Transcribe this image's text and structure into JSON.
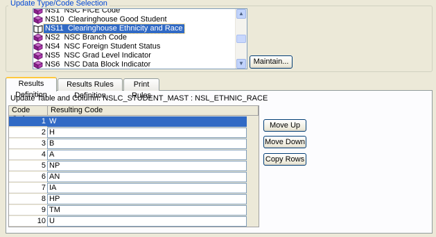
{
  "selection_group": {
    "title": "Update Type/Code Selection",
    "items": [
      {
        "code": "NS1",
        "label": "NSC FICE Code"
      },
      {
        "code": "NS10",
        "label": "Clearinghouse Good Student"
      },
      {
        "code": "NS11",
        "label": "Clearinghouse Ethnicity and Race",
        "selected": true
      },
      {
        "code": "NS2",
        "label": "NSC Branch Code"
      },
      {
        "code": "NS4",
        "label": "NSC Foreign Student Status"
      },
      {
        "code": "NS5",
        "label": "NSC Grad Level Indicator"
      },
      {
        "code": "NS6",
        "label": "NSC Data Block Indicator"
      }
    ],
    "maintain_label": "Maintain..."
  },
  "tabs": [
    {
      "label": "Results Definition",
      "active": true
    },
    {
      "label": "Results Rules Definition"
    },
    {
      "label": "Print Rules"
    }
  ],
  "results": {
    "update_label": "Update Table and Column: NSLC_STUDENT_MAST : NSL_ETHNIC_RACE",
    "columns": [
      "Code Order",
      "Resulting Code"
    ],
    "rows": [
      {
        "order": "1",
        "code": "W"
      },
      {
        "order": "2",
        "code": "H"
      },
      {
        "order": "3",
        "code": "B"
      },
      {
        "order": "4",
        "code": "A"
      },
      {
        "order": "5",
        "code": "NP"
      },
      {
        "order": "6",
        "code": "AN"
      },
      {
        "order": "7",
        "code": "IA"
      },
      {
        "order": "8",
        "code": "HP"
      },
      {
        "order": "9",
        "code": "TM"
      },
      {
        "order": "10",
        "code": "U"
      }
    ],
    "buttons": {
      "move_up": "Move Up",
      "move_down": "Move Down",
      "copy_rows": "Copy Rows"
    }
  },
  "colors": {
    "selection": "#316ac5",
    "accent": "#0046d5",
    "icon_book": "#8a1f8a"
  }
}
